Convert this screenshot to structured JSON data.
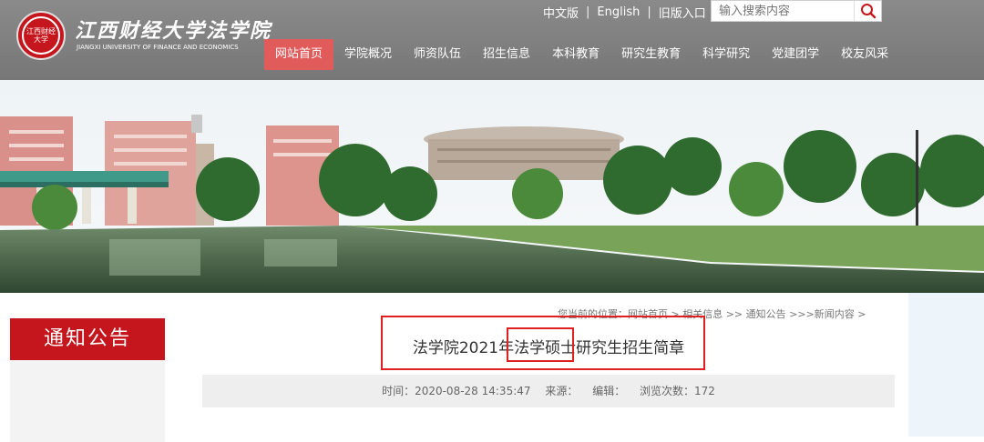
{
  "header": {
    "brand_cn": "江西财经大学法学院",
    "brand_en": "JIANGXI UNIVERSITY OF FINANCE AND ECONOMICS",
    "logo_text": "江西财经大学",
    "top_links": [
      "中文版",
      "English",
      "旧版入口"
    ],
    "separator": "|",
    "search": {
      "placeholder": "输入搜索内容"
    }
  },
  "nav": {
    "items": [
      {
        "label": "网站首页"
      },
      {
        "label": "学院概况"
      },
      {
        "label": "师资队伍"
      },
      {
        "label": "招生信息"
      },
      {
        "label": "本科教育"
      },
      {
        "label": "研究生教育"
      },
      {
        "label": "科学研究"
      },
      {
        "label": "党建团学"
      },
      {
        "label": "校友风采"
      }
    ],
    "active_index": 0
  },
  "sidebar": {
    "title": "通知公告"
  },
  "breadcrumb": {
    "prefix": "您当前的位置：",
    "path": "网站首页 > 相关信息 >> 通知公告 >>>新闻内容 >"
  },
  "article": {
    "title": "法学院2021年法学硕士研究生招生简章",
    "time_label": "时间：2020-08-28 14:35:47",
    "source_label": "来源：",
    "editor_label": "编辑：",
    "views_label": "浏览次数：172"
  },
  "colors": {
    "brand_red": "#c4161c",
    "nav_active": "#e25b5b",
    "header_gray": "#808080"
  }
}
